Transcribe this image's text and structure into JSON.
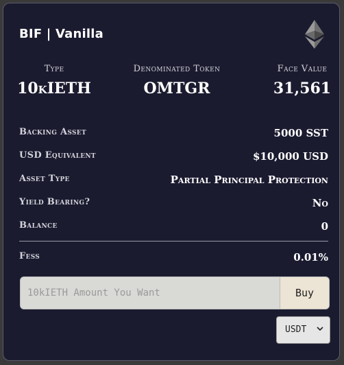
{
  "header": {
    "title": "BIF | Vanilla",
    "icon": "ethereum-icon"
  },
  "summary": {
    "type_label": "Type",
    "type_value": "10kIETH",
    "token_label": "Denominated Token",
    "token_value": "OMTGR",
    "face_label": "Face Value",
    "face_value": "31,561"
  },
  "details": {
    "backing_asset_label": "Backing Asset",
    "backing_asset_value": "5000 SST",
    "usd_equiv_label": "USD Equivalent",
    "usd_equiv_value": "$10,000 USD",
    "asset_type_label": "Asset Type",
    "asset_type_value": "Partial Principal Protection",
    "yield_label": "Yield Bearing?",
    "yield_value": "No",
    "balance_label": "Balance",
    "balance_value": "0",
    "fees_label": "Fess",
    "fees_value": "0.01%"
  },
  "purchase": {
    "amount_placeholder": "10kIETH Amount You Want",
    "amount_value": "",
    "buy_label": "Buy",
    "currency_selected": "USDT"
  },
  "colors": {
    "card_bg": "#1b1b30",
    "buy_bg": "#ece4d4",
    "input_bg": "#d9d9d6"
  }
}
